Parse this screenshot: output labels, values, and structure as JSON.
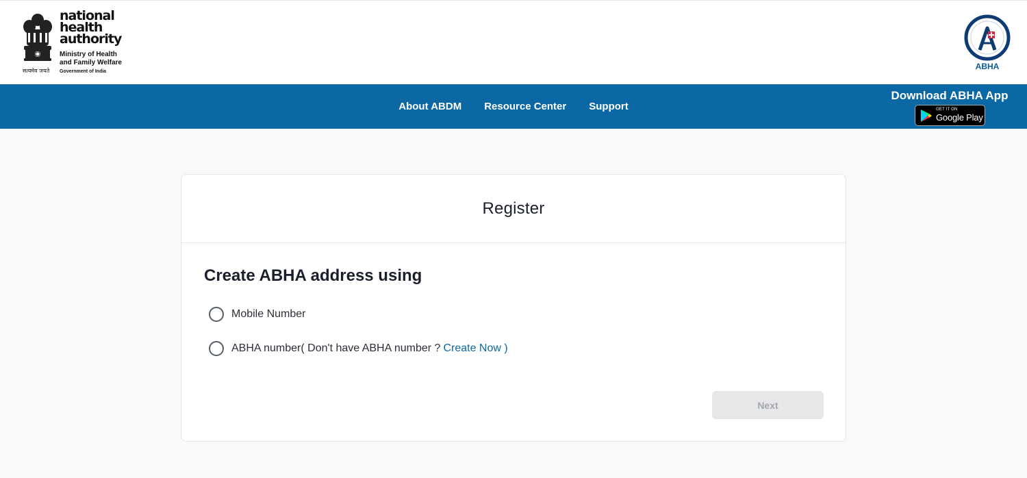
{
  "header": {
    "nha_logo": {
      "line1": "national",
      "line2": "health",
      "line3": "authority",
      "ministry_line1": "Ministry of Health",
      "ministry_line2": "and Family Welfare",
      "ministry_line3": "Government of India",
      "emblem_caption": "सत्यमेव जयते"
    },
    "abha_logo_label": "ABHA"
  },
  "nav": {
    "links": [
      "About ABDM",
      "Resource Center",
      "Support"
    ],
    "download_title": "Download ABHA App",
    "google_play": {
      "small": "GET IT ON",
      "big": "Google Play"
    }
  },
  "card": {
    "title": "Register",
    "section_title": "Create ABHA address using",
    "options": [
      {
        "label": "Mobile Number",
        "selected": false
      },
      {
        "label": "ABHA number( Don't have ABHA number ?",
        "link": "Create Now )",
        "selected": false
      }
    ],
    "next_button": "Next"
  },
  "colors": {
    "nav_bg": "#0b68a4",
    "link": "#0b68a4",
    "page_bg": "#f8f9fb",
    "disabled_button_bg": "#e6e7e9"
  },
  "icons": [
    "national-emblem-icon",
    "abha-logo-icon",
    "google-play-icon",
    "radio-button-icon"
  ]
}
